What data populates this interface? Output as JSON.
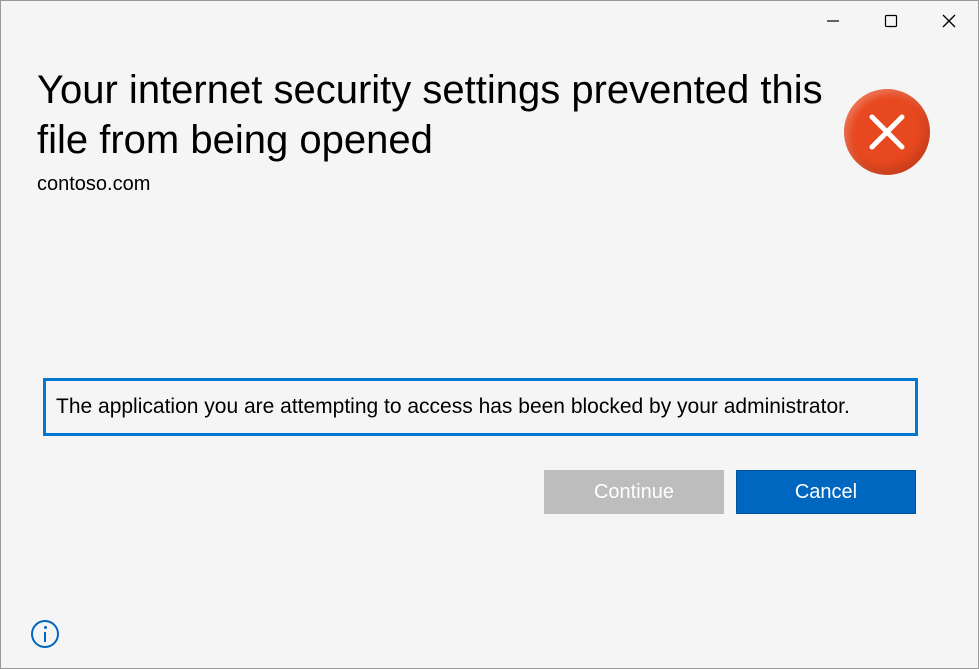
{
  "heading": "Your internet security settings prevented this file from being opened",
  "domain": "contoso.com",
  "message": "The application you are attempting to access has been blocked by your administrator.",
  "buttons": {
    "continue": "Continue",
    "cancel": "Cancel"
  }
}
